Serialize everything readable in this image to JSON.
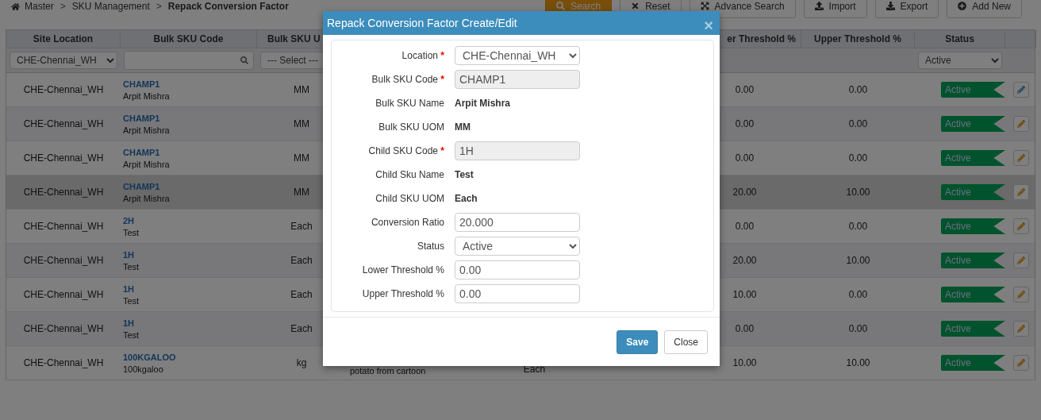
{
  "breadcrumb": [
    {
      "kind": "home",
      "label": "Master"
    },
    {
      "kind": "separator",
      "label": ">"
    },
    {
      "kind": "link",
      "label": "SKU Management"
    },
    {
      "kind": "separator",
      "label": ">"
    },
    {
      "kind": "current",
      "label": "Repack Conversion Factor"
    }
  ],
  "toolbar": [
    {
      "label": "Search",
      "kind": "primary"
    },
    {
      "label": "Reset",
      "kind": "default"
    },
    {
      "label": "Advance Search",
      "kind": "default"
    },
    {
      "label": "Import",
      "kind": "default"
    },
    {
      "label": "Export",
      "kind": "default"
    },
    {
      "label": "Add New",
      "kind": "default"
    }
  ],
  "table": {
    "columns": [
      {
        "label": "Site Location"
      },
      {
        "label": "Bulk SKU Code"
      },
      {
        "label": "Bulk SKU U"
      },
      {
        "label": "er Threshold %"
      },
      {
        "label": "Upper Threshold %"
      },
      {
        "label": "Status"
      }
    ],
    "filters": {
      "site": "CHE-Chennai_WH",
      "uom": "--- Select ---",
      "status": "Active"
    },
    "rows": [
      {
        "site": "CHE-Chennai_WH",
        "code": "CHAMP1",
        "name": "Arpit Mishra",
        "uom": "MM",
        "lower": "0.00",
        "upper": "0.00",
        "status": "Active",
        "highlighted": false,
        "editing": true
      },
      {
        "site": "CHE-Chennai_WH",
        "code": "CHAMP1",
        "name": "Arpit Mishra",
        "uom": "MM",
        "lower": "0.00",
        "upper": "0.00",
        "status": "Active",
        "highlighted": false,
        "editing": false
      },
      {
        "site": "CHE-Chennai_WH",
        "code": "CHAMP1",
        "name": "Arpit Mishra",
        "uom": "MM",
        "lower": "0.00",
        "upper": "0.00",
        "status": "Active",
        "highlighted": false,
        "editing": false
      },
      {
        "site": "CHE-Chennai_WH",
        "code": "CHAMP1",
        "name": "Arpit Mishra",
        "uom": "MM",
        "lower": "20.00",
        "upper": "10.00",
        "status": "Active",
        "highlighted": true,
        "editing": false
      },
      {
        "site": "CHE-Chennai_WH",
        "code": "2H",
        "name": "Test",
        "uom": "Each",
        "lower": "0.00",
        "upper": "0.00",
        "status": "Active",
        "highlighted": false,
        "editing": false
      },
      {
        "site": "CHE-Chennai_WH",
        "code": "1H",
        "name": "Test",
        "uom": "Each",
        "lower": "20.00",
        "upper": "10.00",
        "status": "Active",
        "highlighted": false,
        "editing": false
      },
      {
        "site": "CHE-Chennai_WH",
        "code": "1H",
        "name": "Test",
        "uom": "Each",
        "lower": "10.00",
        "upper": "0.00",
        "status": "Active",
        "highlighted": false,
        "editing": false
      },
      {
        "site": "CHE-Chennai_WH",
        "code": "1H",
        "name": "Test",
        "uom": "Each",
        "lower": "0.00",
        "upper": "0.00",
        "status": "Active",
        "highlighted": false,
        "editing": false
      },
      {
        "site": "CHE-Chennai_WH",
        "code": "100KGALOO",
        "name": "100kgaloo",
        "uom": "kg",
        "child_name": "potato from cartoon",
        "child_uom": "Each",
        "lower": "10.00",
        "upper": "10.00",
        "status": "Active",
        "highlighted": false,
        "editing": false
      }
    ]
  },
  "modal": {
    "title": "Repack Conversion Factor Create/Edit",
    "close": "×",
    "fields": [
      {
        "label": "Location",
        "required_mark": "*",
        "kind": "select",
        "value": "CHE-Chennai_WH"
      },
      {
        "label": "Bulk SKU Code",
        "required_mark": "*",
        "kind": "readonly",
        "value": "CHAMP1"
      },
      {
        "label": "Bulk SKU Name",
        "kind": "text",
        "value": "Arpit Mishra"
      },
      {
        "label": "Bulk SKU UOM",
        "kind": "text",
        "value": "MM"
      },
      {
        "label": "Child SKU Code",
        "required_mark": "*",
        "kind": "readonly",
        "value": "1H"
      },
      {
        "label": "Child Sku Name",
        "kind": "text",
        "value": "Test"
      },
      {
        "label": "Child SKU UOM",
        "kind": "text",
        "value": "Each"
      },
      {
        "label": "Conversion Ratio",
        "kind": "input",
        "value": "20.000"
      },
      {
        "label": "Status",
        "kind": "select",
        "value": "Active"
      },
      {
        "label": "Lower Threshold %",
        "kind": "input",
        "value": "0.00"
      },
      {
        "label": "Upper Threshold %",
        "kind": "input",
        "value": "0.00"
      }
    ],
    "buttons": [
      {
        "label": "Save",
        "kind": "primary"
      },
      {
        "label": "Close",
        "kind": "default"
      }
    ]
  }
}
